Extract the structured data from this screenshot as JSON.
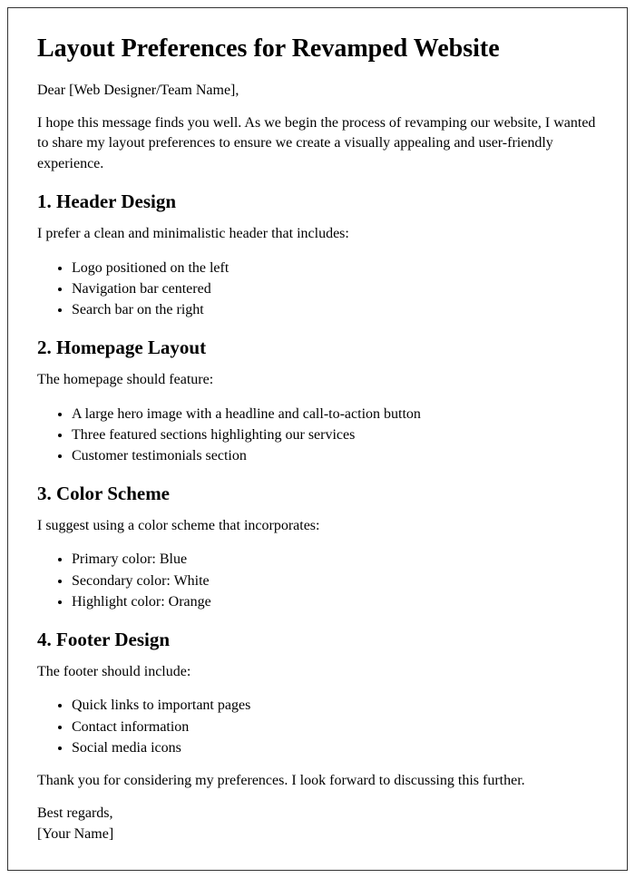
{
  "title": "Layout Preferences for Revamped Website",
  "greeting": "Dear [Web Designer/Team Name],",
  "intro": "I hope this message finds you well. As we begin the process of revamping our website, I wanted to share my layout preferences to ensure we create a visually appealing and user-friendly experience.",
  "sections": [
    {
      "heading": "1. Header Design",
      "lead": "I prefer a clean and minimalistic header that includes:",
      "items": [
        "Logo positioned on the left",
        "Navigation bar centered",
        "Search bar on the right"
      ]
    },
    {
      "heading": "2. Homepage Layout",
      "lead": "The homepage should feature:",
      "items": [
        "A large hero image with a headline and call-to-action button",
        "Three featured sections highlighting our services",
        "Customer testimonials section"
      ]
    },
    {
      "heading": "3. Color Scheme",
      "lead": "I suggest using a color scheme that incorporates:",
      "items": [
        "Primary color: Blue",
        "Secondary color: White",
        "Highlight color: Orange"
      ]
    },
    {
      "heading": "4. Footer Design",
      "lead": "The footer should include:",
      "items": [
        "Quick links to important pages",
        "Contact information",
        "Social media icons"
      ]
    }
  ],
  "closing": "Thank you for considering my preferences. I look forward to discussing this further.",
  "signoff1": "Best regards,",
  "signoff2": "[Your Name]"
}
